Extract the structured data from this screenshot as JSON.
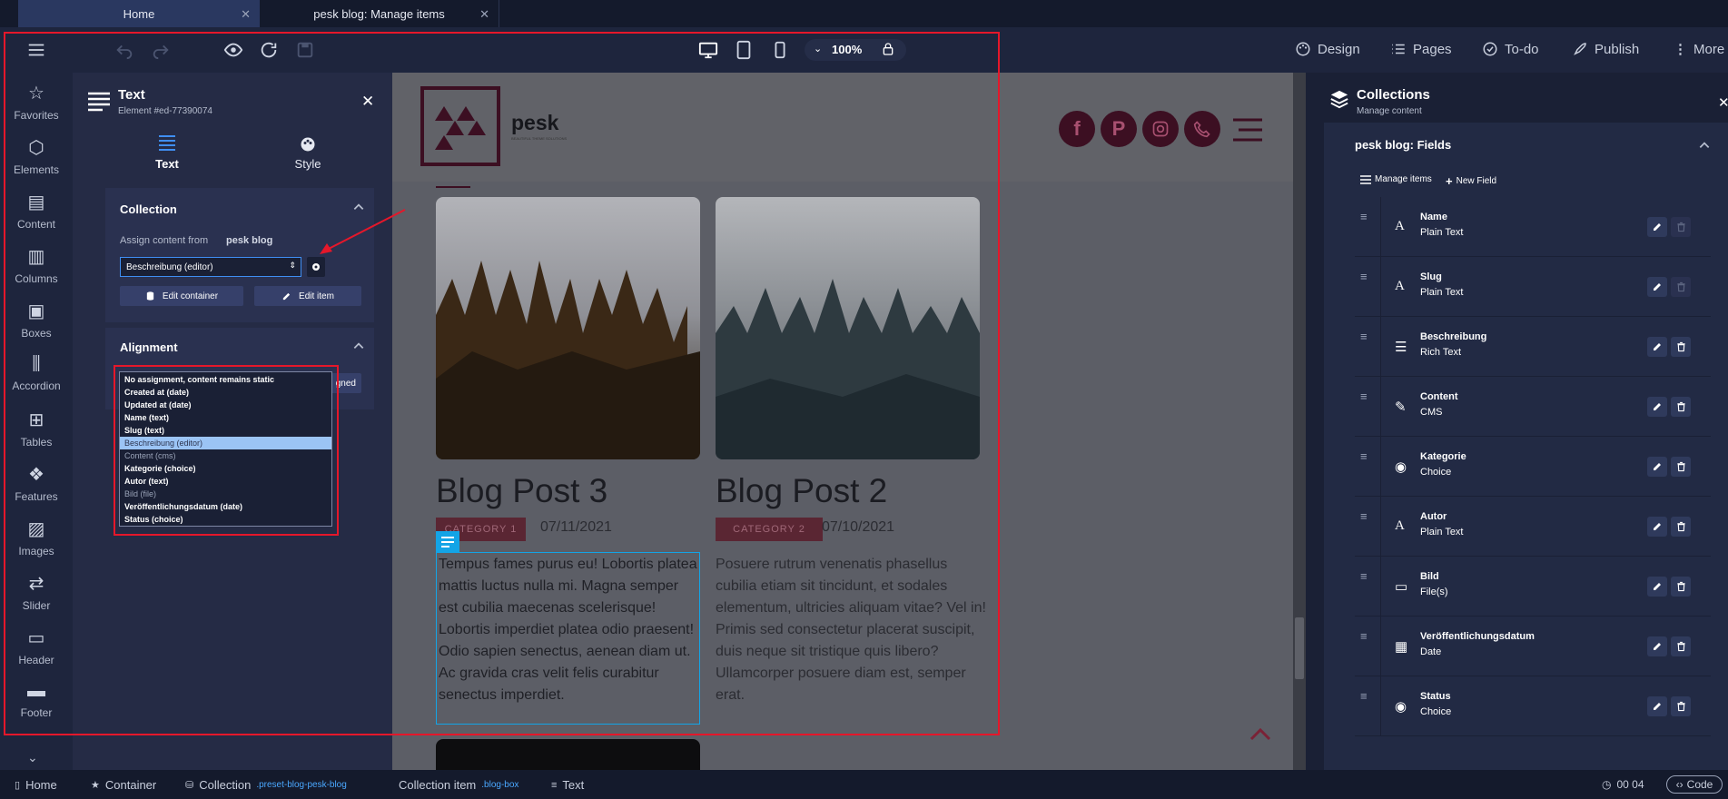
{
  "tabs": [
    {
      "label": "Home"
    },
    {
      "label": "pesk blog: Manage items"
    }
  ],
  "toolbar": {
    "zoom": "100%",
    "design": "Design",
    "pages": "Pages",
    "todo": "To-do",
    "publish": "Publish",
    "more": "More"
  },
  "rail": [
    "Favorites",
    "Elements",
    "Content",
    "Columns",
    "Boxes",
    "Accordion",
    "Tables",
    "Features",
    "Images",
    "Slider",
    "Header",
    "Footer"
  ],
  "props": {
    "title": "Text",
    "subtitle": "Element #ed-77390074",
    "tab_text": "Text",
    "tab_style": "Style",
    "collection_heading": "Collection",
    "assign_label": "Assign content from",
    "assign_source": "pesk blog",
    "select_value": "Beschreibung (editor)",
    "edit_container": "Edit container",
    "edit_item": "Edit item",
    "alignment_heading": "Alignment",
    "aligned_partial": "gned",
    "dropdown_options": [
      "No assignment, content remains static",
      "Created at (date)",
      "Updated at (date)",
      "Name (text)",
      "Slug (text)",
      "Beschreibung (editor)",
      "Content (cms)",
      "Kategorie (choice)",
      "Autor (text)",
      "Bild (file)",
      "Veröffentlichungsdatum (date)",
      "Status (choice)"
    ]
  },
  "site": {
    "logo_text": "pesk",
    "logo_tagline": "BEAUTIFUL THEME SOLUTIONS",
    "post3": {
      "title": "Blog Post 3",
      "category": "CATEGORY 1",
      "date": "07/11/2021",
      "body": "Tempus fames purus eu! Lobortis platea mattis luctus nulla mi. Magna semper est cubilia maecenas scelerisque! Lobortis imperdiet platea odio praesent! Odio sapien senectus, aenean diam ut. Ac gravida cras velit felis curabitur senectus imperdiet."
    },
    "post2": {
      "title": "Blog Post 2",
      "category": "CATEGORY 2",
      "date": "07/10/2021",
      "body": "Posuere rutrum venenatis phasellus cubilia etiam sit tincidunt, et sodales elementum, ultricies aliquam vitae? Vel in! Primis sed consectetur placerat suscipit, duis neque sit tristique quis libero? Ullamcorper posuere diam est, semper erat."
    }
  },
  "collections": {
    "title": "Collections",
    "subtitle": "Manage content",
    "fields_heading": "pesk blog: Fields",
    "manage_items": "Manage items",
    "new_field": "New Field",
    "fields": [
      {
        "name": "Name",
        "type": "Plain Text",
        "icon": "text-icon"
      },
      {
        "name": "Slug",
        "type": "Plain Text",
        "icon": "text-icon"
      },
      {
        "name": "Beschreibung",
        "type": "Rich Text",
        "icon": "rich-text-icon"
      },
      {
        "name": "Content",
        "type": "CMS",
        "icon": "edit-icon"
      },
      {
        "name": "Kategorie",
        "type": "Choice",
        "icon": "choice-icon"
      },
      {
        "name": "Autor",
        "type": "Plain Text",
        "icon": "text-icon"
      },
      {
        "name": "Bild",
        "type": "File(s)",
        "icon": "image-icon"
      },
      {
        "name": "Veröffentlichungsdatum",
        "type": "Date",
        "icon": "calendar-icon"
      },
      {
        "name": "Status",
        "type": "Choice",
        "icon": "choice-icon"
      }
    ]
  },
  "breadcrumb": {
    "home": "Home",
    "container": "Container",
    "collection": "Collection",
    "collection_class": ".preset-blog-pesk-blog",
    "item": "Collection item",
    "item_class": ".blog-box",
    "text": "Text"
  },
  "status": {
    "time": "00 04",
    "code": "Code"
  },
  "colors": {
    "accent": "#a63552",
    "highlight": "#e5172a",
    "selection": "#13a4e6"
  }
}
